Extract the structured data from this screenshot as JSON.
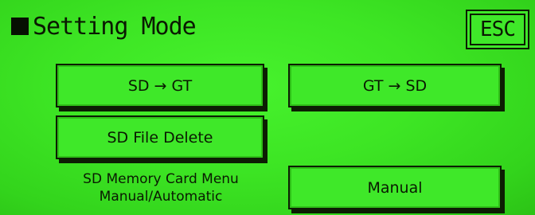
{
  "header": {
    "title": "Setting Mode",
    "esc_label": "ESC"
  },
  "buttons": {
    "sd_to_gt": "SD → GT",
    "gt_to_sd": "GT → SD",
    "sd_file_delete": "SD File Delete",
    "manual": "Manual"
  },
  "info": {
    "line1": "SD Memory Card Menu",
    "line2": "Manual/Automatic"
  },
  "colors": {
    "screen_background": "#3de524",
    "text": "#0a1a02"
  }
}
